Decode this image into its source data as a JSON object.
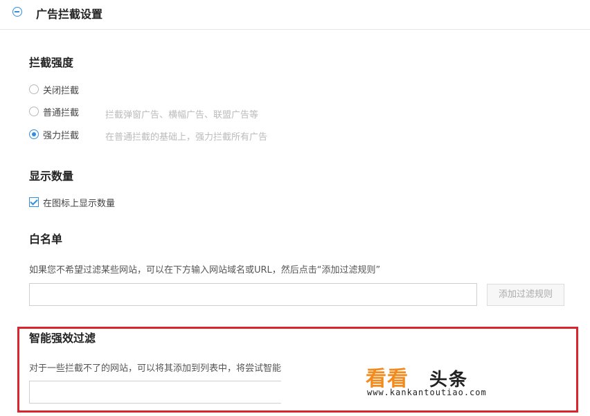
{
  "header": {
    "title": "广告拦截设置",
    "icon": "collapse-icon"
  },
  "intensity": {
    "title": "拦截强度",
    "options": [
      {
        "label": "关闭拦截",
        "desc": "",
        "checked": false
      },
      {
        "label": "普通拦截",
        "desc": "拦截弹窗广告、横幅广告、联盟广告等",
        "checked": false
      },
      {
        "label": "强力拦截",
        "desc": "在普通拦截的基础上，强力拦截所有广告",
        "checked": true
      }
    ]
  },
  "count": {
    "title": "显示数量",
    "checkbox_label": "在图标上显示数量",
    "checked": true
  },
  "whitelist": {
    "title": "白名单",
    "description": "如果您不希望过滤某些网站，可以在下方输入网站域名或URL，然后点击“添加过滤规则”",
    "input_value": "",
    "button_label": "添加过滤规则"
  },
  "smart": {
    "title": "智能强效过滤",
    "description": "对于一些拦截不了的网站，可以将其添加到列表中，将尝试智能",
    "input_value": ""
  },
  "watermark": {
    "main": "看看",
    "side": "头条",
    "url": "www.kankantoutiao.com"
  },
  "colors": {
    "accent": "#2f8ee0",
    "highlight_frame": "#d9232d",
    "watermark": "#f28a1c"
  }
}
